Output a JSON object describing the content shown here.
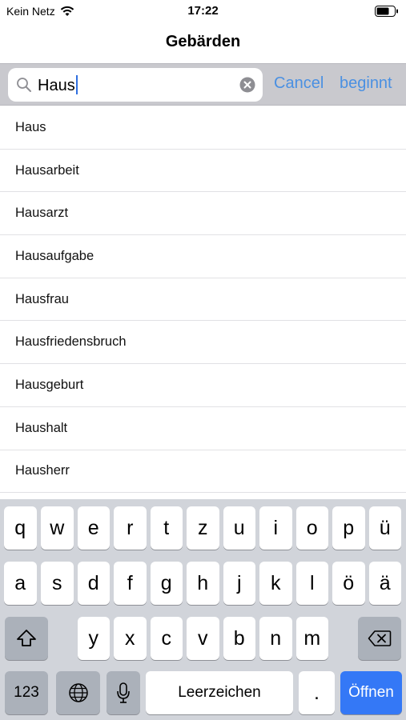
{
  "status_bar": {
    "carrier": "Kein Netz",
    "time": "17:22"
  },
  "nav": {
    "title": "Gebärden"
  },
  "search": {
    "value": "Haus",
    "cancel_label": "Cancel",
    "scope_label": "beginnt"
  },
  "results": [
    "Haus",
    "Hausarbeit",
    "Hausarzt",
    "Hausaufgabe",
    "Hausfrau",
    "Hausfriedensbruch",
    "Hausgeburt",
    "Haushalt",
    "Hausherr"
  ],
  "keyboard": {
    "row1": [
      "q",
      "w",
      "e",
      "r",
      "t",
      "z",
      "u",
      "i",
      "o",
      "p",
      "ü"
    ],
    "row2": [
      "a",
      "s",
      "d",
      "f",
      "g",
      "h",
      "j",
      "k",
      "l",
      "ö",
      "ä"
    ],
    "row3": [
      "y",
      "x",
      "c",
      "v",
      "b",
      "n",
      "m"
    ],
    "numbers_label": "123",
    "space_label": "Leerzeichen",
    "period_label": ".",
    "return_label": "Öffnen"
  },
  "colors": {
    "accent": "#4a90e2",
    "return_key": "#3478f6",
    "keyboard_bg": "#d1d4da"
  }
}
